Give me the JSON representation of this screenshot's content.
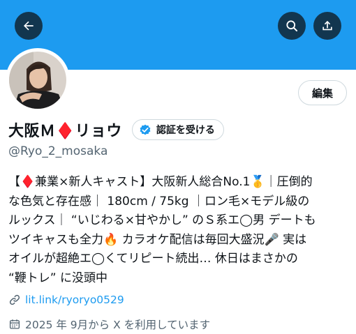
{
  "header": {
    "back_icon": "arrow-left-icon",
    "search_icon": "search-icon",
    "share_icon": "share-icon",
    "banner_color": "#1d9bf0"
  },
  "profile": {
    "edit_label": "編集",
    "name": "大阪Ｍ♦️リョウ",
    "verify_label": "認証を受ける",
    "handle": "@Ryo_2_mosaka",
    "bio_lines": [
      "【♦️兼業×新人キャスト】大阪新人総合No.1🥇｜圧倒的",
      "な色気と存在感｜ 180cm / 75kg ｜ロン毛×モデル級の",
      "ルックス｜ “いじわる×甘やかし” のＳ系エ◯男 デートも",
      "ツイキャスも全力🔥 カラオケ配信は毎回大盛況🎤 実は",
      "オイルが超絶エ◯くてリピート続出… 休日はまさかの",
      "“鞭トレ” に没頭中"
    ],
    "link": "lit.link/ryoryo0529",
    "joined": "2025 年 9月から X を利用しています"
  },
  "colors": {
    "accent": "#1d9bf0",
    "secondary_text": "#536471",
    "primary_text": "#0f1419"
  }
}
